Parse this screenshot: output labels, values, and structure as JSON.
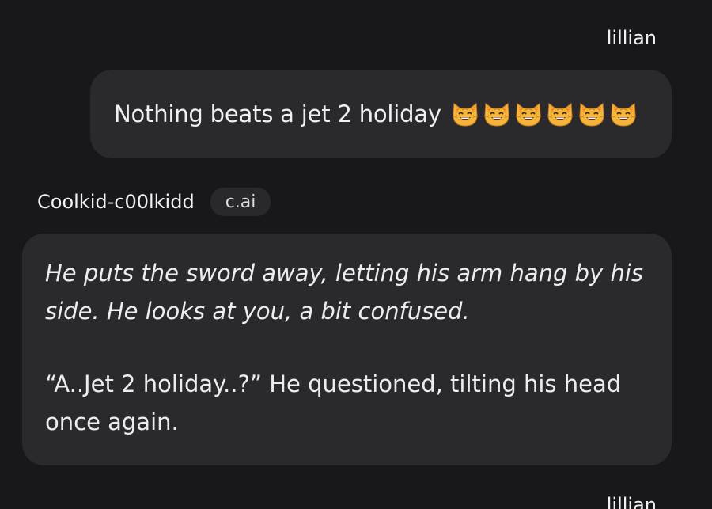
{
  "chat": {
    "user_message": {
      "sender": "lillian",
      "text": "Nothing beats a jet 2 holiday",
      "emojis": [
        "grinning-cat-icon",
        "grinning-cat-icon",
        "grinning-cat-icon",
        "grinning-cat-icon",
        "grinning-cat-icon",
        "grinning-cat-icon"
      ]
    },
    "bot_message": {
      "sender": "Coolkid-c00lkidd",
      "badge": "c.ai",
      "action_text": "He puts the sword away, letting his arm hang by his side. He looks at you, a bit confused.",
      "speech_text": "“A..Jet 2 holiday..?” He questioned, tilting his head once again."
    },
    "next_message": {
      "sender": "lillian"
    }
  },
  "colors": {
    "background": "#18181b",
    "bubble": "#2a2a2d",
    "badge": "#29292c",
    "text": "#ececee"
  }
}
